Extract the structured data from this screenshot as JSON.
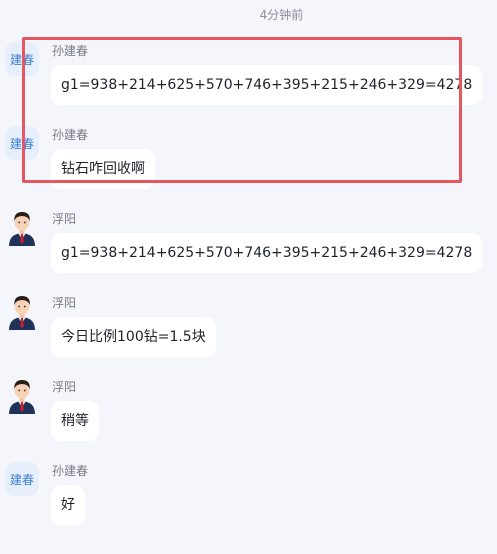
{
  "timestamp": "4分钟前",
  "colors": {
    "highlight": "#e5565e",
    "avatar_text": "#3a7fd5",
    "background": "#f5f6fb"
  },
  "messages": [
    {
      "sender": "孙建春",
      "avatar_label": "建春",
      "avatar_type": "text",
      "text": "g1=938+214+625+570+746+395+215+246+329=4278"
    },
    {
      "sender": "孙建春",
      "avatar_label": "建春",
      "avatar_type": "text",
      "text": "钻石咋回收啊"
    },
    {
      "sender": "浮阳",
      "avatar_label": "",
      "avatar_type": "person-icon",
      "text": "g1=938+214+625+570+746+395+215+246+329=4278"
    },
    {
      "sender": "浮阳",
      "avatar_label": "",
      "avatar_type": "person-icon",
      "text": "今日比例100钻=1.5块"
    },
    {
      "sender": "浮阳",
      "avatar_label": "",
      "avatar_type": "person-icon",
      "text": "稍等"
    },
    {
      "sender": "孙建春",
      "avatar_label": "建春",
      "avatar_type": "text",
      "text": "好"
    }
  ]
}
